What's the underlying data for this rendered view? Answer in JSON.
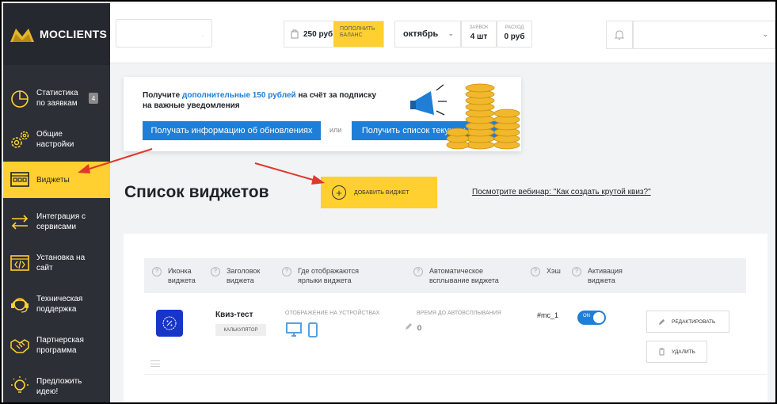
{
  "brand": {
    "name": "MOCLIENTS"
  },
  "sidebar": {
    "items": [
      {
        "label": "Статистика по заявкам",
        "badge": "4",
        "icon": "pie-chart-icon"
      },
      {
        "label": "Общие настройки",
        "icon": "gears-icon"
      },
      {
        "label": "Виджеты",
        "icon": "widget-icon",
        "active": true
      },
      {
        "label": "Интеграция с сервисами",
        "icon": "swap-arrows-icon"
      },
      {
        "label": "Установка на сайт",
        "icon": "code-window-icon"
      },
      {
        "label": "Техническая поддержка",
        "icon": "headset-icon"
      },
      {
        "label": "Партнерская программа",
        "icon": "handshake-icon"
      },
      {
        "label": "Предложить идею!",
        "icon": "lightbulb-icon"
      }
    ]
  },
  "header": {
    "balance": "250 руб",
    "topup_label": "ПОПОЛНИТЬ БАЛАНС",
    "month": "октябрь",
    "requests_label": "ЗАЯВОК",
    "requests_value": "4 шт",
    "expense_label": "РАСХОД",
    "expense_value": "0 руб"
  },
  "promo": {
    "text_before": "Получите ",
    "highlight": "дополнительные 150 рублей",
    "text_after": " на счёт за подписку",
    "line2": "на важные уведомления",
    "btn_updates": "Получать информацию об обновлениях",
    "or": "или",
    "btn_promos": "Получить список текущих акций"
  },
  "page": {
    "title": "Список виджетов",
    "add_widget": "ДОБАВИТЬ ВИДЖЕТ",
    "webinar_link": "Посмотрите вебинар: \"Как создать крутой квиз?\""
  },
  "table": {
    "headers": {
      "icon": "Иконка виджета",
      "title": "Заголовок виджета",
      "where": "Где отображаются ярлыки виджета",
      "auto": "Автоматическое всплывание виджета",
      "hash": "Хэш",
      "active": "Активация виджета"
    },
    "row": {
      "name": "Квиз-тест",
      "type": "КАЛЬКУЛЯТОР",
      "devices_label": "ОТОБРАЖЕНИЕ НА УСТРОЙСТВАХ",
      "popup_label": "ВРЕМЯ ДО АВТОВСПЛЫВАНИЯ",
      "popup_value": "0",
      "hash": "#mc_1",
      "toggle": "ON",
      "edit": "РЕДАКТИРОВАТЬ",
      "delete": "УДАЛИТЬ"
    }
  },
  "colors": {
    "accent": "#ffd02f",
    "primary": "#1f7fd6",
    "sidebar": "#2c2f36",
    "annotation": "#e0372c"
  }
}
